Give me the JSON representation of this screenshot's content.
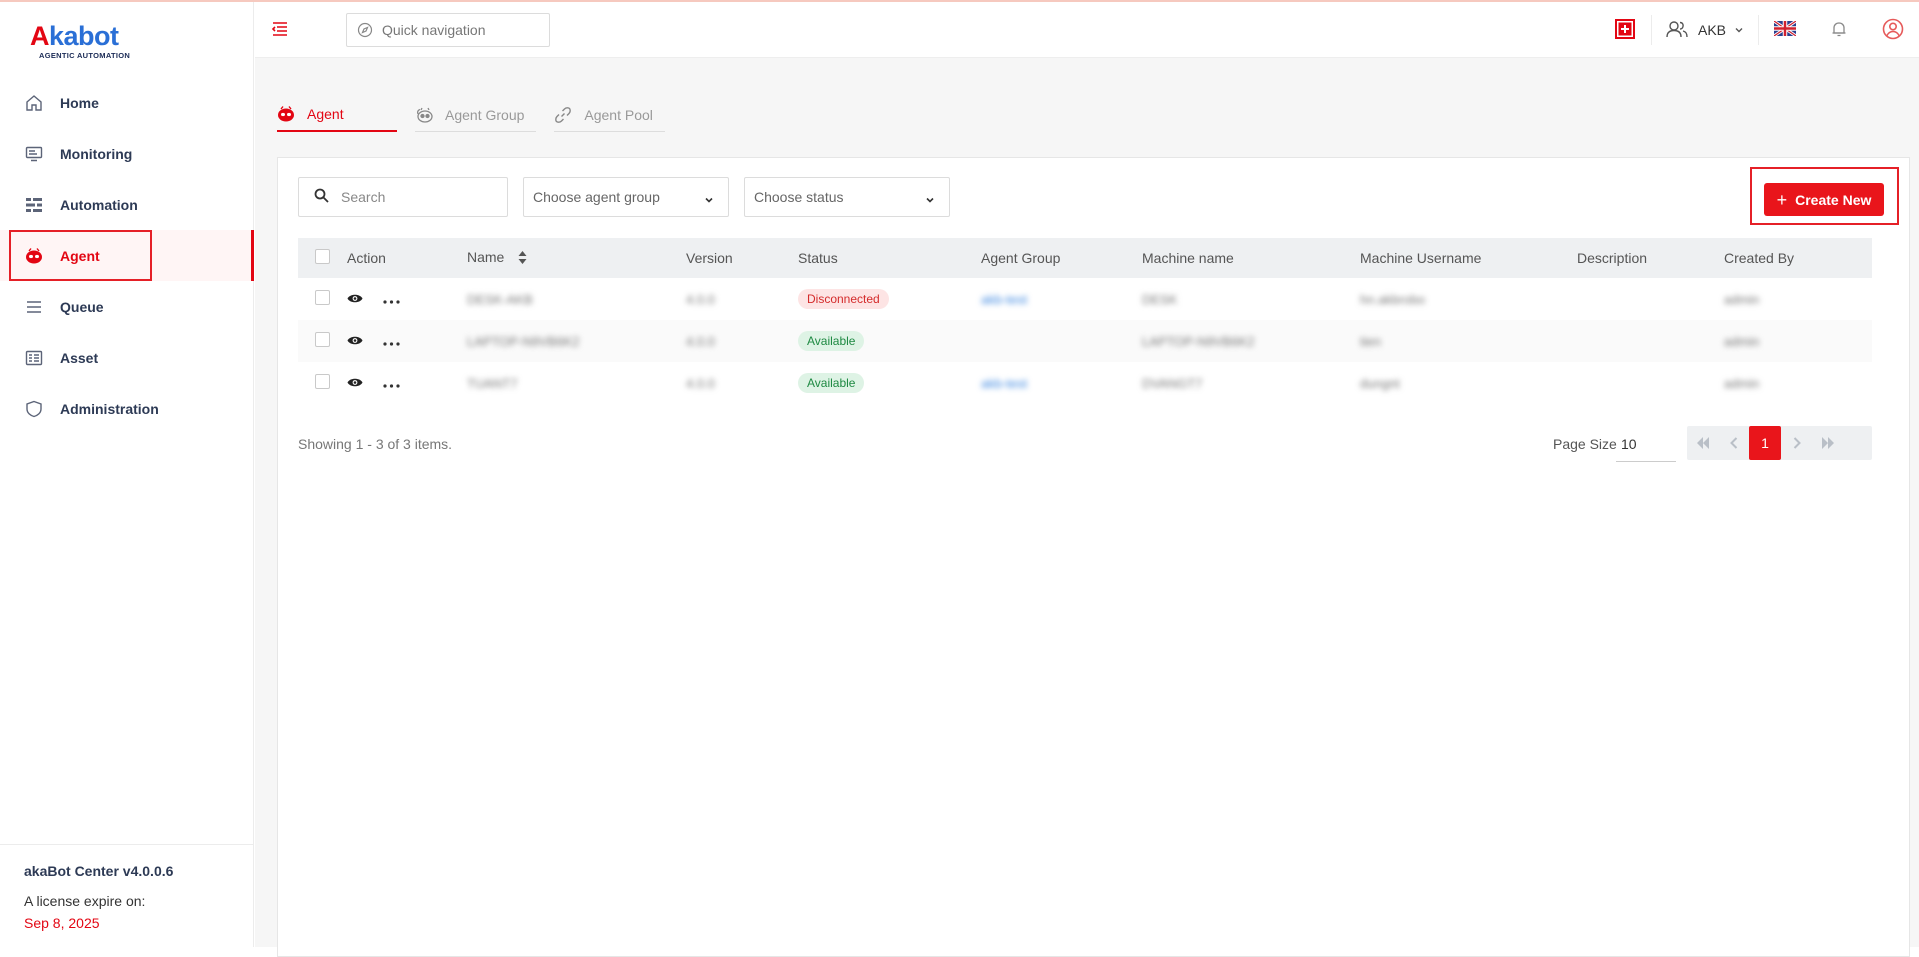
{
  "brand": {
    "logo_text_a": "A",
    "logo_text_b": "kabot",
    "tagline": "AGENTIC AUTOMATION"
  },
  "sidebar": {
    "items": [
      {
        "label": "Home",
        "icon": "home-icon"
      },
      {
        "label": "Monitoring",
        "icon": "monitor-icon"
      },
      {
        "label": "Automation",
        "icon": "automation-icon"
      },
      {
        "label": "Agent",
        "icon": "agent-icon",
        "active": true
      },
      {
        "label": "Queue",
        "icon": "queue-icon"
      },
      {
        "label": "Asset",
        "icon": "asset-icon"
      },
      {
        "label": "Administration",
        "icon": "shield-icon"
      }
    ],
    "footer": {
      "version": "akaBot Center v4.0.0.6",
      "license_label": "A license expire on:",
      "license_date": "Sep 8, 2025"
    }
  },
  "header": {
    "quick_nav_placeholder": "Quick navigation",
    "tenant": "AKB"
  },
  "tabs": [
    {
      "label": "Agent",
      "icon": "agent-icon",
      "active": true
    },
    {
      "label": "Agent Group",
      "icon": "agent-group-icon"
    },
    {
      "label": "Agent Pool",
      "icon": "link-icon"
    }
  ],
  "toolbar": {
    "search_placeholder": "Search",
    "group_placeholder": "Choose agent group",
    "status_placeholder": "Choose status",
    "create_label": "Create New"
  },
  "table": {
    "columns": [
      "Action",
      "Name",
      "Version",
      "Status",
      "Agent Group",
      "Machine name",
      "Machine Username",
      "Description",
      "Created By"
    ],
    "rows": [
      {
        "name": "DESK-AKB",
        "version": "4.0.0",
        "status": "Disconnected",
        "status_kind": "disc",
        "group": "akb-test",
        "machine": "DESK",
        "username": "hn.akbrobo",
        "description": "",
        "created_by": "admin"
      },
      {
        "name": "LAPTOP-N9VB6K2",
        "version": "4.0.0",
        "status": "Available",
        "status_kind": "avail",
        "group": "",
        "machine": "LAPTOP-N9VB6K2",
        "username": "tien",
        "description": "",
        "created_by": "admin"
      },
      {
        "name": "TUANT7",
        "version": "4.0.0",
        "status": "Available",
        "status_kind": "avail",
        "group": "akb-test",
        "machine": "DVANGT7",
        "username": "dungnt",
        "description": "",
        "created_by": "admin"
      }
    ]
  },
  "pagination": {
    "showing": "Showing 1 - 3 of 3 items.",
    "page_size_label": "Page Size",
    "page_size": "10",
    "current_page": "1"
  },
  "colors": {
    "accent": "#e9151b",
    "success": "#1f8a43",
    "danger": "#d42b2b"
  }
}
